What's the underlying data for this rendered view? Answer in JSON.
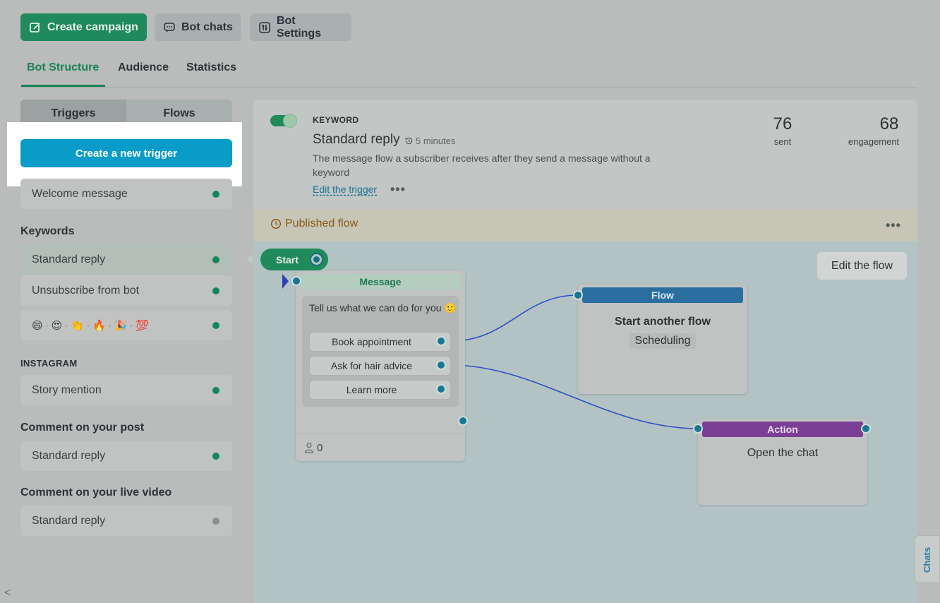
{
  "top_actions": {
    "create_campaign": "Create campaign",
    "bot_chats": "Bot chats",
    "bot_settings": "Bot Settings"
  },
  "main_tabs": [
    "Bot Structure",
    "Audience",
    "Statistics"
  ],
  "sidebar": {
    "segment": [
      "Triggers",
      "Flows"
    ],
    "create_trigger": "Create a new trigger",
    "welcome": "Welcome message",
    "keywords_heading": "Keywords",
    "keywords": [
      "Standard reply",
      "Unsubscribe from bot"
    ],
    "emoji_keywords": [
      "😄",
      "😍",
      "👏",
      "🔥",
      "🎉",
      "💯"
    ],
    "instagram_heading": "INSTAGRAM",
    "story_mention": "Story mention",
    "comment_post_heading": "Comment on your post",
    "comment_post_item": "Standard reply",
    "comment_live_heading": "Comment on your live video",
    "comment_live_item": "Standard reply",
    "collapse": "<"
  },
  "trigger": {
    "type": "KEYWORD",
    "title": "Standard reply",
    "time": "5 minutes",
    "description": "The message flow a subscriber receives after they send a message without a keyword",
    "edit_link": "Edit the trigger",
    "more": "•••",
    "enabled": true
  },
  "stats": [
    {
      "value": "76",
      "label": "sent"
    },
    {
      "value": "68",
      "label": "engagement"
    }
  ],
  "published": {
    "label": "Published flow",
    "more": "•••"
  },
  "canvas": {
    "edit_flow": "Edit the flow",
    "start": "Start",
    "message_node": {
      "header": "Message",
      "text": "Tell us what we can do for you 🙂",
      "buttons": [
        "Book appointment",
        "Ask for hair advice",
        "Learn more"
      ],
      "subscriber_count": "0"
    },
    "flow_node": {
      "header": "Flow",
      "title": "Start another flow",
      "flow_name": "Scheduling"
    },
    "action_node": {
      "header": "Action",
      "text": "Open the chat"
    }
  },
  "chats_tab": "Chats",
  "colors": {
    "brand_green": "#1f8a5a",
    "trigger_blue": "#0a9cc9",
    "flow_header": "#2a6fa0",
    "action_header": "#7b3f96",
    "connector": "#2f4fc4"
  }
}
